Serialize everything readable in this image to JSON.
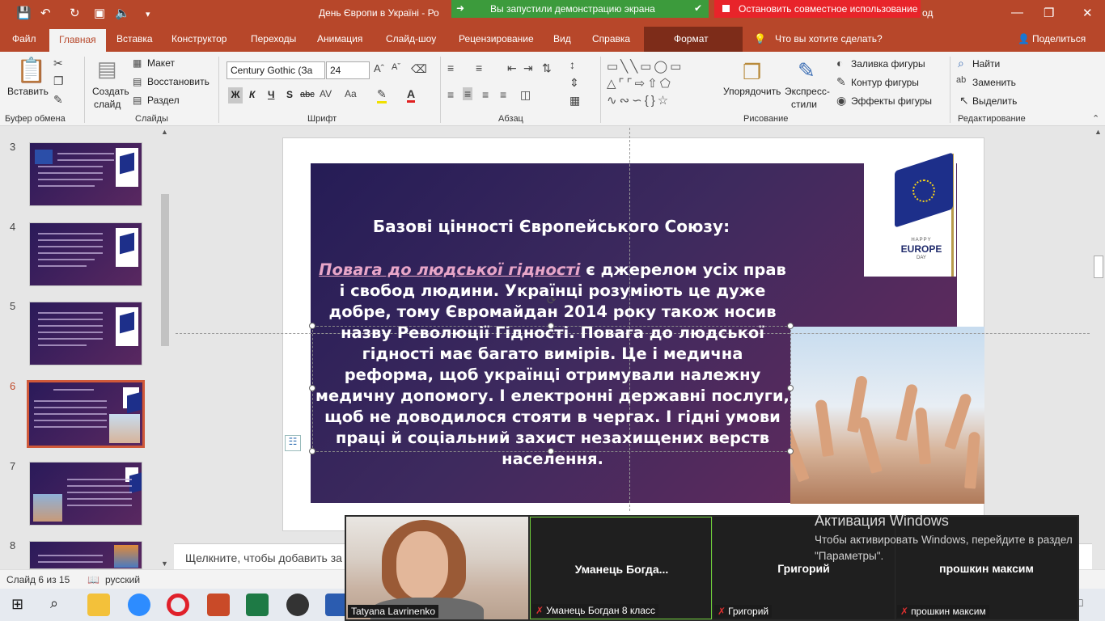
{
  "window": {
    "title": "День Європи в Україні  -  Ро",
    "title_suffix": "од",
    "share_notice": "Вы запустили демонстрацию экрана",
    "stop_share": "Остановить совместное использование"
  },
  "tabs": [
    "Файл",
    "Главная",
    "Вставка",
    "Конструктор",
    "Переходы",
    "Анимация",
    "Слайд-шоу",
    "Рецензирование",
    "Вид",
    "Справка",
    "Формат"
  ],
  "tell_me": "Что вы хотите сделать?",
  "share_button": "Поделиться",
  "ribbon": {
    "paste": "Вставить",
    "new_slide_1": "Создать",
    "new_slide_2": "слайд",
    "layout": "Макет",
    "reset": "Восстановить",
    "section": "Раздел",
    "font_name": "Century Gothic (За",
    "font_size": "24",
    "arrange": "Упорядочить",
    "quick_styles_1": "Экспресс-",
    "quick_styles_2": "стили",
    "shape_fill": "Заливка фигуры",
    "shape_outline": "Контур фигуры",
    "shape_effects": "Эффекты фигуры",
    "find": "Найти",
    "replace": "Заменить",
    "select": "Выделить",
    "groups": {
      "clipboard": "Буфер обмена",
      "slides": "Слайды",
      "font": "Шрифт",
      "paragraph": "Абзац",
      "drawing": "Рисование",
      "editing": "Редактирование"
    },
    "format_buttons": [
      "Ж",
      "К",
      "Ч",
      "S",
      "abc"
    ]
  },
  "thumbnails": [
    "3",
    "4",
    "5",
    "6",
    "7",
    "8"
  ],
  "slide": {
    "title": "Базові цінності Європейського Союзу:",
    "body_highlight": "Повага до людської гідності",
    "body_rest": " є джерелом усіх прав і свобод людини. Українці розуміють це дуже добре, тому Євромайдан 2014 року також носив назву Революції Гідності. Повага до людської гідності має багато вимірів. Це і медична реформа, щоб українці отримували належну медичну допомогу. І електронні державні послуги, щоб не доводилося стояти в чергах. І гідні умови праці й соціальний захист незахищених верств населення.",
    "logo_happy": "HAPPY",
    "logo_europe": "EUROPE",
    "logo_day": "DAY"
  },
  "notes_placeholder": "Щелкните, чтобы добавить за",
  "status": {
    "slide_counter": "Слайд 6 из 15",
    "language": "русский"
  },
  "video": {
    "self_caption": "Tatyana Lavrinenko",
    "participants": [
      {
        "name": "Уманець  Богда...",
        "caption": "Уманець Богдан 8 класс"
      },
      {
        "name": "Григорий",
        "caption": "Григорий"
      },
      {
        "name": "прошкин максим",
        "caption": "прошкин максим"
      }
    ]
  },
  "activation": {
    "title": "Активация Windows",
    "subtitle": "Чтобы активировать Windows, перейдите в раздел \"Параметры\"."
  },
  "colors": {
    "accent": "#b7472a",
    "share_green": "#3c9b3c",
    "stop_red": "#e8242a",
    "slide_purple": "#3e2a5e"
  }
}
